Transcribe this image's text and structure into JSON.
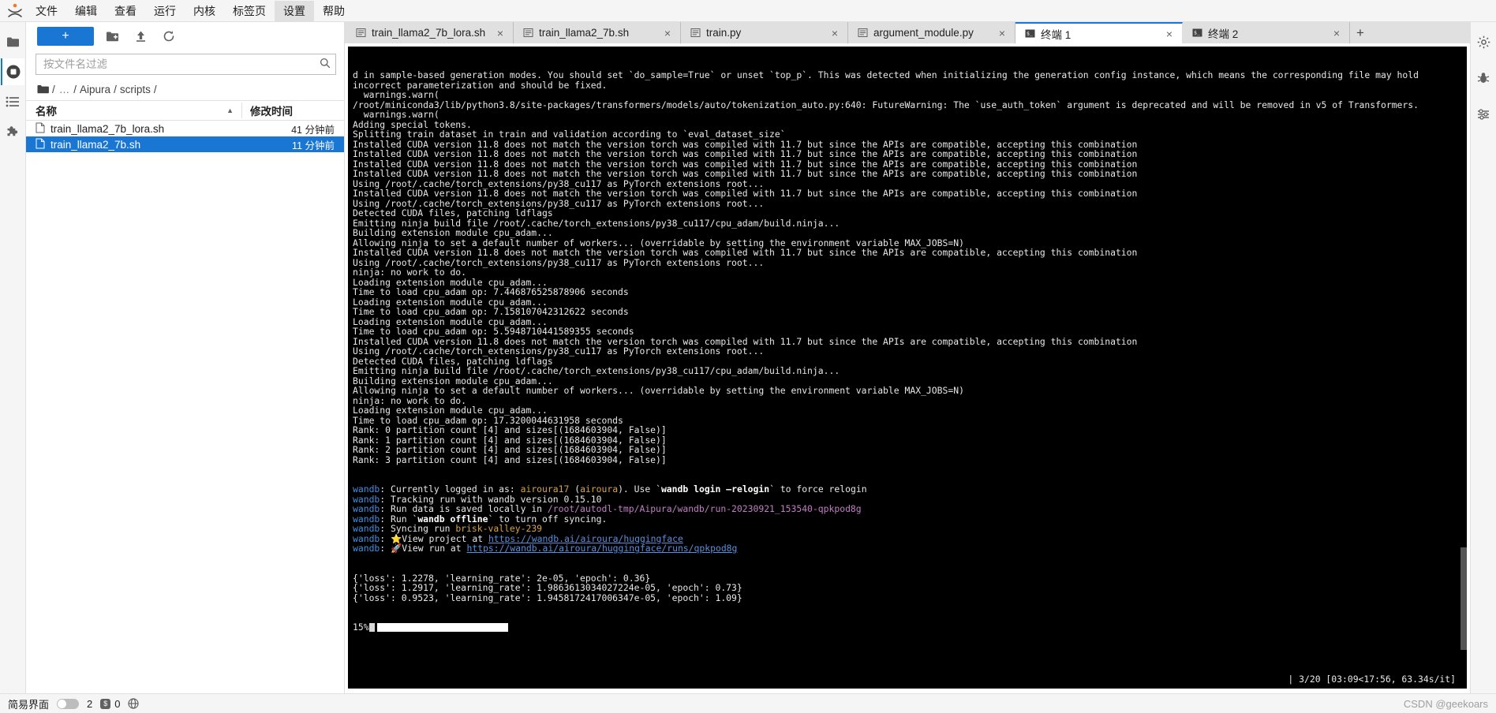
{
  "menubar": {
    "logo": "jupyter-logo",
    "items": [
      {
        "label": "文件",
        "active": false
      },
      {
        "label": "编辑",
        "active": false
      },
      {
        "label": "查看",
        "active": false
      },
      {
        "label": "运行",
        "active": false
      },
      {
        "label": "内核",
        "active": false
      },
      {
        "label": "标签页",
        "active": false
      },
      {
        "label": "设置",
        "active": true
      },
      {
        "label": "帮助",
        "active": false
      }
    ]
  },
  "activity_bar": {
    "items": [
      {
        "name": "file-browser-icon",
        "glyph": "folder"
      },
      {
        "name": "running-terminals-icon",
        "glyph": "stop-circle"
      },
      {
        "name": "table-of-contents-icon",
        "glyph": "list"
      },
      {
        "name": "extension-manager-icon",
        "glyph": "puzzle"
      }
    ]
  },
  "filebrowser": {
    "new_button_label": "+",
    "toolbar_icons": [
      {
        "name": "new-folder-icon",
        "glyph": "folder-plus"
      },
      {
        "name": "upload-icon",
        "glyph": "upload"
      },
      {
        "name": "refresh-icon",
        "glyph": "refresh"
      }
    ],
    "filter": {
      "placeholder": "按文件名过滤",
      "value": "",
      "icon": "search-icon"
    },
    "breadcrumb": {
      "home_icon": "folder-icon",
      "parts": [
        "/",
        "…",
        "/",
        "Aipura",
        "/",
        "scripts",
        "/"
      ]
    },
    "columns": {
      "name": "名称",
      "modified": "修改时间"
    },
    "rows": [
      {
        "icon": "file-icon",
        "name": "train_llama2_7b_lora.sh",
        "modified": "41 分钟前",
        "selected": false
      },
      {
        "icon": "file-icon",
        "name": "train_llama2_7b.sh",
        "modified": "11 分钟前",
        "selected": true
      }
    ]
  },
  "tabbar": {
    "tabs": [
      {
        "label": "train_llama2_7b_lora.sh",
        "icon": "text-file-icon",
        "active": false,
        "close": "×"
      },
      {
        "label": "train_llama2_7b.sh",
        "icon": "text-file-icon",
        "active": false,
        "close": "×"
      },
      {
        "label": "train.py",
        "icon": "text-file-icon",
        "active": false,
        "close": "×"
      },
      {
        "label": "argument_module.py",
        "icon": "text-file-icon",
        "active": false,
        "close": "×"
      },
      {
        "label": "终端 1",
        "icon": "terminal-icon",
        "active": true,
        "close": "×"
      },
      {
        "label": "终端 2",
        "icon": "terminal-icon",
        "active": false,
        "close": "×"
      }
    ],
    "add_label": "+"
  },
  "terminal": {
    "lines": [
      "d in sample-based generation modes. You should set `do_sample=True` or unset `top_p`. This was detected when initializing the generation config instance, which means the corresponding file may hold",
      "incorrect parameterization and should be fixed.",
      "  warnings.warn(",
      "/root/miniconda3/lib/python3.8/site-packages/transformers/models/auto/tokenization_auto.py:640: FutureWarning: The `use_auth_token` argument is deprecated and will be removed in v5 of Transformers.",
      "  warnings.warn(",
      "Adding special tokens.",
      "Splitting train dataset in train and validation according to `eval_dataset_size`",
      "Installed CUDA version 11.8 does not match the version torch was compiled with 11.7 but since the APIs are compatible, accepting this combination",
      "Installed CUDA version 11.8 does not match the version torch was compiled with 11.7 but since the APIs are compatible, accepting this combination",
      "Installed CUDA version 11.8 does not match the version torch was compiled with 11.7 but since the APIs are compatible, accepting this combination",
      "Installed CUDA version 11.8 does not match the version torch was compiled with 11.7 but since the APIs are compatible, accepting this combination",
      "Using /root/.cache/torch_extensions/py38_cu117 as PyTorch extensions root...",
      "Installed CUDA version 11.8 does not match the version torch was compiled with 11.7 but since the APIs are compatible, accepting this combination",
      "Using /root/.cache/torch_extensions/py38_cu117 as PyTorch extensions root...",
      "Detected CUDA files, patching ldflags",
      "Emitting ninja build file /root/.cache/torch_extensions/py38_cu117/cpu_adam/build.ninja...",
      "Building extension module cpu_adam...",
      "Allowing ninja to set a default number of workers... (overridable by setting the environment variable MAX_JOBS=N)",
      "Installed CUDA version 11.8 does not match the version torch was compiled with 11.7 but since the APIs are compatible, accepting this combination",
      "Using /root/.cache/torch_extensions/py38_cu117 as PyTorch extensions root...",
      "ninja: no work to do.",
      "Loading extension module cpu_adam...",
      "Time to load cpu_adam op: 7.446876525878906 seconds",
      "Loading extension module cpu_adam...",
      "Time to load cpu_adam op: 7.158107042312622 seconds",
      "Loading extension module cpu_adam...",
      "Time to load cpu_adam op: 5.5948710441589355 seconds",
      "Installed CUDA version 11.8 does not match the version torch was compiled with 11.7 but since the APIs are compatible, accepting this combination",
      "Using /root/.cache/torch_extensions/py38_cu117 as PyTorch extensions root...",
      "Detected CUDA files, patching ldflags",
      "Emitting ninja build file /root/.cache/torch_extensions/py38_cu117/cpu_adam/build.ninja...",
      "Building extension module cpu_adam...",
      "Allowing ninja to set a default number of workers... (overridable by setting the environment variable MAX_JOBS=N)",
      "ninja: no work to do.",
      "Loading extension module cpu_adam...",
      "Time to load cpu_adam op: 17.3200044631958 seconds",
      "Rank: 0 partition count [4] and sizes[(1684603904, False)]",
      "Rank: 1 partition count [4] and sizes[(1684603904, False)]",
      "Rank: 2 partition count [4] and sizes[(1684603904, False)]",
      "Rank: 3 partition count [4] and sizes[(1684603904, False)]"
    ],
    "wandb_lines": [
      {
        "prefix": "wandb",
        "segments": [
          {
            "t": ": Currently logged in as: ",
            "c": "plain"
          },
          {
            "t": "airoura17",
            "c": "yellow"
          },
          {
            "t": " (",
            "c": "plain"
          },
          {
            "t": "airoura",
            "c": "yellow"
          },
          {
            "t": "). Use ",
            "c": "plain"
          },
          {
            "t": "`",
            "c": "plain"
          },
          {
            "t": "wandb login —relogin",
            "c": "bold"
          },
          {
            "t": "`",
            "c": "plain"
          },
          {
            "t": " to force relogin",
            "c": "plain"
          }
        ]
      },
      {
        "prefix": "wandb",
        "segments": [
          {
            "t": ": Tracking run with wandb version 0.15.10",
            "c": "plain"
          }
        ]
      },
      {
        "prefix": "wandb",
        "segments": [
          {
            "t": ": Run data is saved locally in ",
            "c": "plain"
          },
          {
            "t": "/root/autodl-tmp/Aipura/wandb/run-20230921_153540-qpkpod8g",
            "c": "pink"
          }
        ]
      },
      {
        "prefix": "wandb",
        "segments": [
          {
            "t": ": Run ",
            "c": "plain"
          },
          {
            "t": "`",
            "c": "plain"
          },
          {
            "t": "wandb offline",
            "c": "bold"
          },
          {
            "t": "`",
            "c": "plain"
          },
          {
            "t": " to turn off syncing.",
            "c": "plain"
          }
        ]
      },
      {
        "prefix": "wandb",
        "segments": [
          {
            "t": ": Syncing run ",
            "c": "plain"
          },
          {
            "t": "brisk-valley-239",
            "c": "yellow"
          }
        ]
      },
      {
        "prefix": "wandb",
        "segments": [
          {
            "t": ": ",
            "c": "plain"
          },
          {
            "t": "⭐",
            "c": "star"
          },
          {
            "t": "View project at ",
            "c": "plain"
          },
          {
            "t": "https://wandb.ai/airoura/huggingface",
            "c": "link"
          }
        ]
      },
      {
        "prefix": "wandb",
        "segments": [
          {
            "t": ": ",
            "c": "plain"
          },
          {
            "t": "🚀",
            "c": "rocket"
          },
          {
            "t": "View run at ",
            "c": "plain"
          },
          {
            "t": "https://wandb.ai/airoura/huggingface/runs/qpkpod8g",
            "c": "link"
          }
        ]
      }
    ],
    "metric_lines": [
      "{'loss': 1.2278, 'learning_rate': 2e-05, 'epoch': 0.36}",
      "{'loss': 1.2917, 'learning_rate': 1.9863613034027224e-05, 'epoch': 0.73}",
      "{'loss': 0.9523, 'learning_rate': 1.9458172417006347e-05, 'epoch': 1.09}"
    ],
    "progress": {
      "percent_label": "15%",
      "percent_value": 15
    },
    "status_right": "| 3/20 [03:09<17:56, 63.34s/it]"
  },
  "right_bar": {
    "items": [
      {
        "name": "settings-gear-icon",
        "glyph": "gear"
      },
      {
        "name": "debugger-icon",
        "glyph": "bug"
      },
      {
        "name": "property-inspector-icon",
        "glyph": "sliders"
      }
    ]
  },
  "statusbar": {
    "simple_mode_label": "简易界面",
    "terminal_count": "2",
    "kernel_count": "0",
    "kernel_icon": "kernel-icon",
    "globe_icon": "globe-icon",
    "watermark": "CSDN @geekoars"
  },
  "colors": {
    "accent": "#1976d2",
    "menubar_bg": "#f5f5f5",
    "terminal_bg": "#000000",
    "terminal_fg": "#e8e8e8",
    "wandb_blue": "#3f8fe0",
    "wandb_yellow": "#d6a445",
    "wandb_pink": "#c27ec4",
    "link": "#5a8ede",
    "selected_row": "#1976d2"
  }
}
